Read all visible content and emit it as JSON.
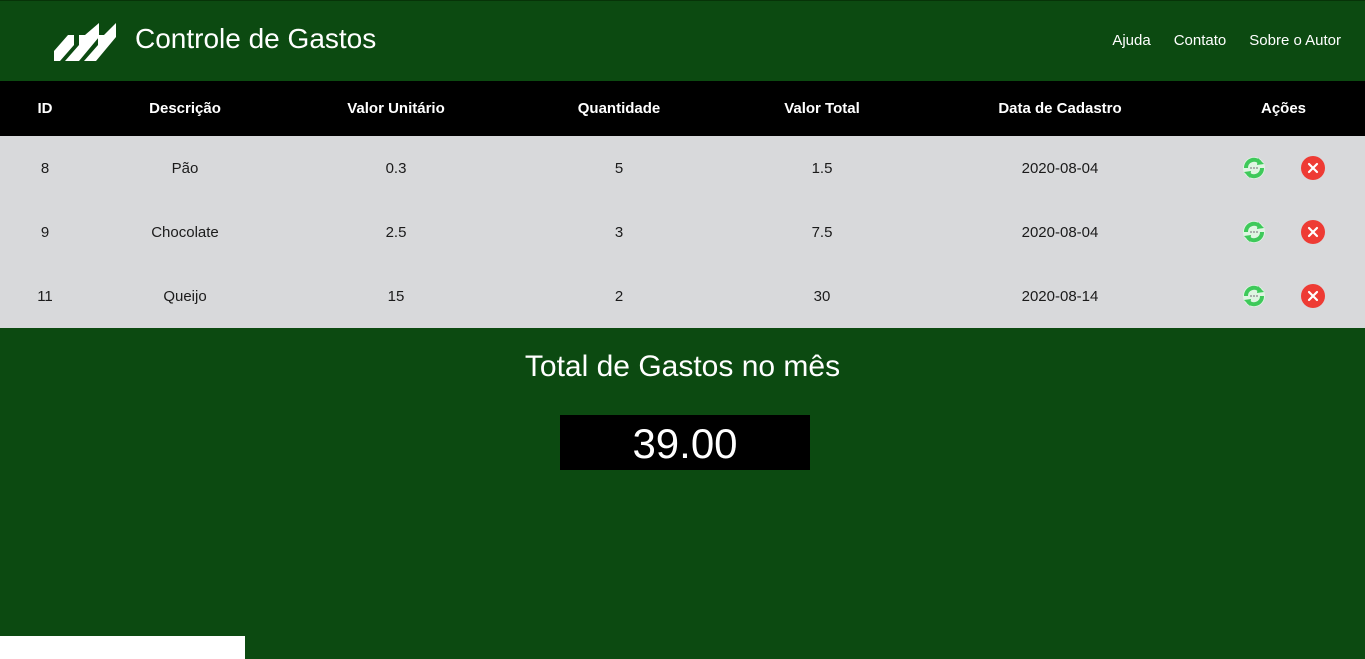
{
  "header": {
    "title": "Controle de Gastos",
    "nav": [
      "Ajuda",
      "Contato",
      "Sobre o Autor"
    ]
  },
  "table": {
    "columns": [
      "ID",
      "Descrição",
      "Valor Unitário",
      "Quantidade",
      "Valor Total",
      "Data de Cadastro",
      "Ações"
    ],
    "rows": [
      {
        "id": "8",
        "descricao": "Pão",
        "valor_unitario": "0.3",
        "quantidade": "5",
        "valor_total": "1.5",
        "data": "2020-08-04"
      },
      {
        "id": "9",
        "descricao": "Chocolate",
        "valor_unitario": "2.5",
        "quantidade": "3",
        "valor_total": "7.5",
        "data": "2020-08-04"
      },
      {
        "id": "11",
        "descricao": "Queijo",
        "valor_unitario": "15",
        "quantidade": "2",
        "valor_total": "30",
        "data": "2020-08-14"
      }
    ]
  },
  "total": {
    "title": "Total de Gastos no mês",
    "value": "39.00"
  },
  "colors": {
    "background": "#0c4a11",
    "header_row": "#000000",
    "body_row": "#d8d9db",
    "edit_icon": "#3ec95a",
    "delete_icon": "#ee3b34"
  },
  "icons": {
    "logo": "stripes-logo-icon",
    "edit": "refresh-edit-icon",
    "delete": "close-circle-icon"
  }
}
